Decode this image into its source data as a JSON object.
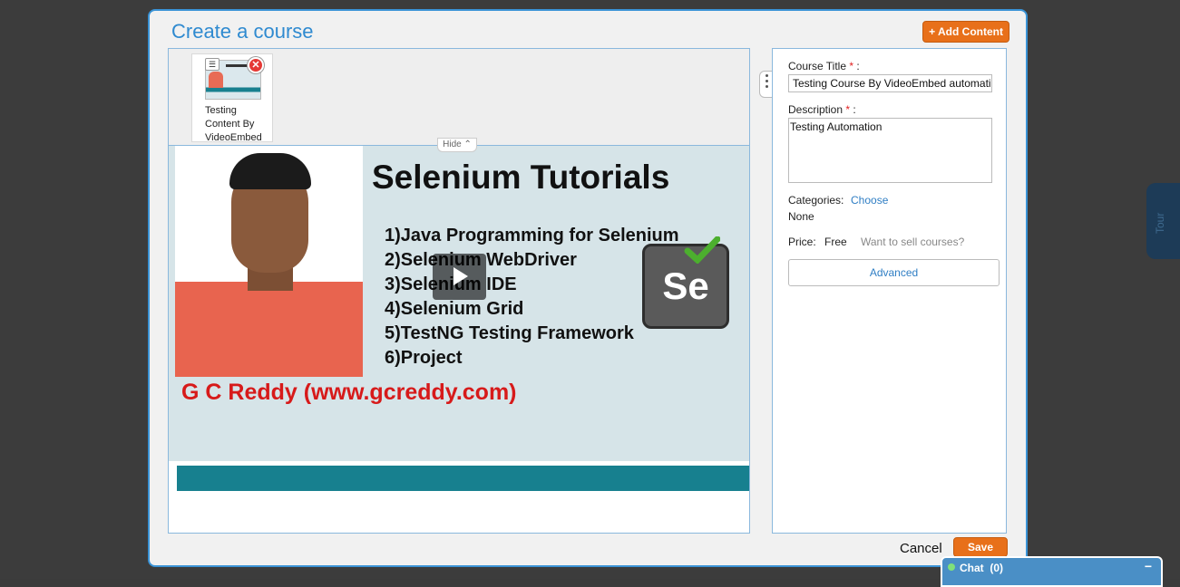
{
  "tour": {
    "label": "Tour"
  },
  "modal": {
    "title": "Create a course",
    "add_content": "+ Add Content",
    "cancel": "Cancel",
    "save": "Save"
  },
  "thumbnail": {
    "caption": "Testing Content By VideoEmbed",
    "menu_glyph": "☰",
    "close_glyph": "✕"
  },
  "content_toggle": {
    "label": "Hide ⌃"
  },
  "video": {
    "heading": "Selenium Tutorials",
    "items": [
      "1)Java Programming for Selenium",
      "2)Selenium WebDriver",
      "3)Selenium IDE",
      "4)Selenium Grid",
      "5)TestNG Testing Framework",
      "6)Project"
    ],
    "credit": "G C Reddy (www.gcreddy.com)",
    "logo_text": "Se"
  },
  "form": {
    "course_title_label": "Course Title",
    "course_title_value": "Testing Course By VideoEmbed automation",
    "description_label": "Description",
    "description_value": "Testing Automation",
    "required_mark": "*",
    "colon": ":",
    "categories_label": "Categories:",
    "categories_choose": "Choose",
    "categories_value": "None",
    "price_label": "Price:",
    "price_value": "Free",
    "sell_link": "Want to sell courses?",
    "advanced": "Advanced"
  },
  "chat": {
    "label": "Chat",
    "count": "(0)",
    "minimize": "−"
  },
  "colors": {
    "accent": "#2f8ad0",
    "button": "#e8701a",
    "chat": "#4a8fc6"
  }
}
